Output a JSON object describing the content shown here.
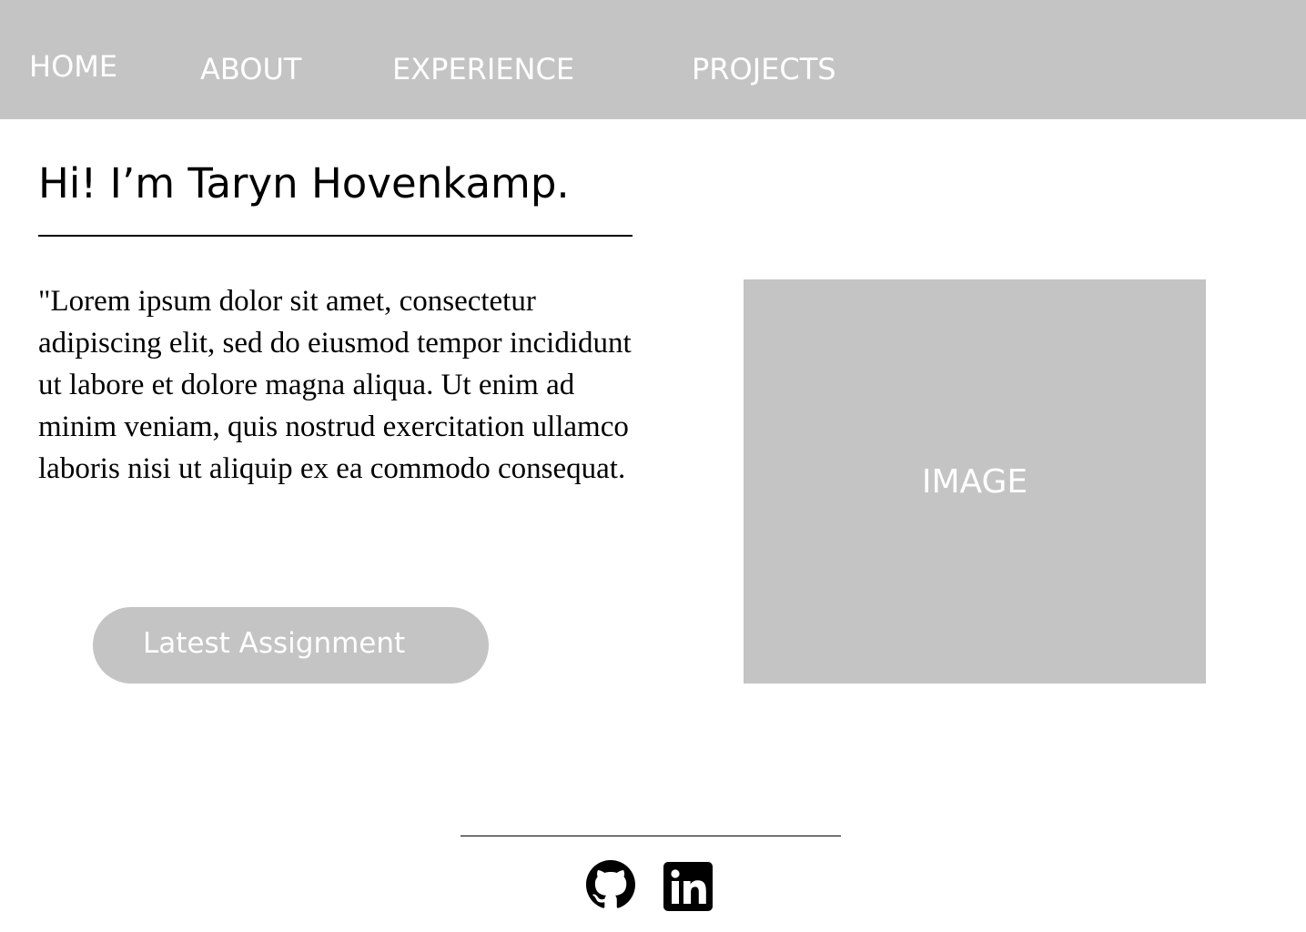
{
  "nav": {
    "items": [
      {
        "label": "HOME"
      },
      {
        "label": "ABOUT"
      },
      {
        "label": "EXPERIENCE"
      },
      {
        "label": "PROJECTS"
      }
    ]
  },
  "hero": {
    "title": "Hi! I’m Taryn Hovenkamp.",
    "intro": "\"Lorem ipsum dolor sit amet, consectetur adipiscing elit, sed do eiusmod tempor incididunt ut labore et dolore magna aliqua. Ut enim ad minim veniam, quis nostrud exercitation ullamco laboris nisi ut aliquip ex ea commodo consequat.",
    "cta_label": "Latest Assignment",
    "image_label": "IMAGE"
  },
  "footer": {
    "icons": [
      "github-icon",
      "linkedin-icon"
    ]
  },
  "colors": {
    "nav_bg": "#c4c4c4",
    "placeholder_gray": "#c4c4c4",
    "text": "#000000",
    "on_gray_text": "#ffffff"
  }
}
